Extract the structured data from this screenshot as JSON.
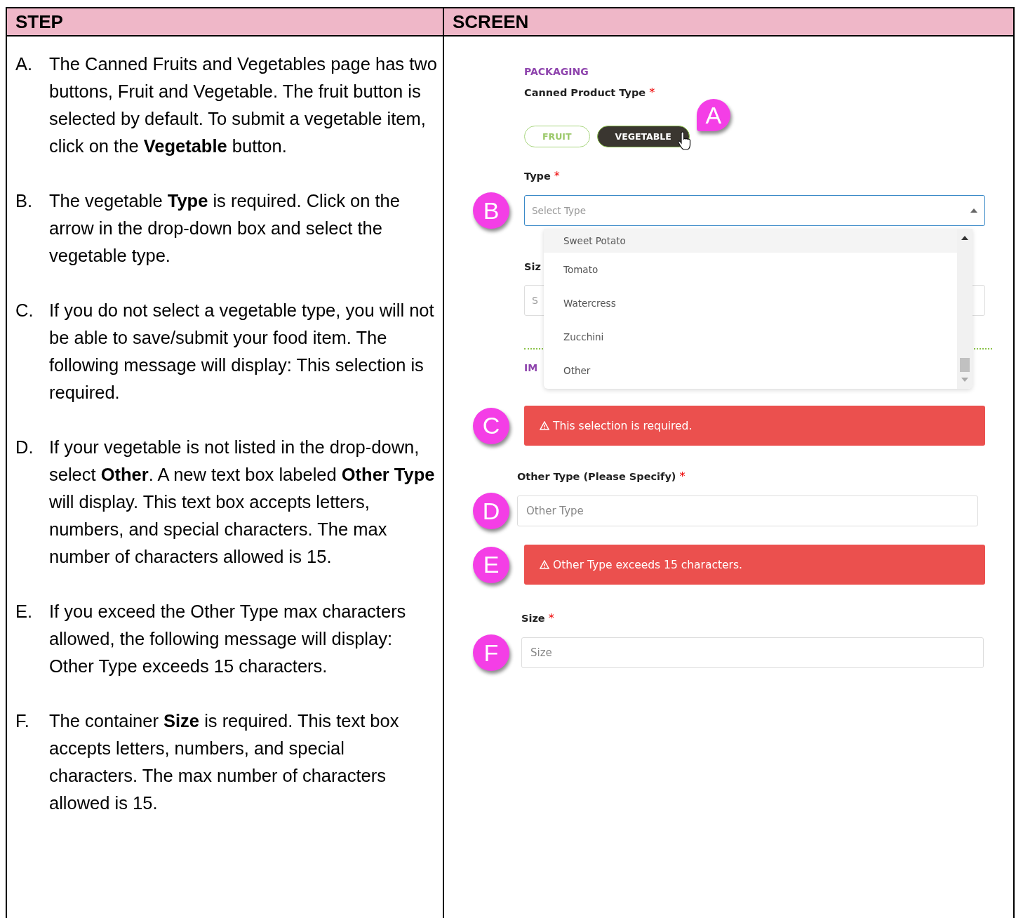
{
  "table": {
    "columns": [
      "STEP",
      "SCREEN"
    ]
  },
  "steps": [
    {
      "marker": "A.",
      "text": "The Canned Fruits and Vegetables page has two buttons, Fruit and Vegetable. The fruit button is selected by default.  To submit a vegetable item, click on the **Vegetable** button."
    },
    {
      "marker": "B.",
      "text": "The vegetable **Type** is required.  Click on the arrow in the drop-down box and select the vegetable type."
    },
    {
      "marker": "C.",
      "text": "If you do not select a vegetable type, you will not be able to save/submit your food item. The following message will display: This selection is required."
    },
    {
      "marker": "D.",
      "text": "If your vegetable is not listed in the drop-down, select **Other**.  A new text box labeled **Other Type** will display.  This text box accepts letters, numbers, and special characters.  The max number of characters allowed is 15."
    },
    {
      "marker": "E.",
      "text": "If you exceed the Other Type max characters allowed, the following message will display:  Other Type exceeds 15 characters."
    },
    {
      "marker": "F.",
      "text": "The container **Size** is required.  This text box accepts letters, numbers, and special characters.  The max number of characters allowed is 15."
    }
  ],
  "screen": {
    "section_title": "PACKAGING",
    "product_type": {
      "label": "Canned Product Type",
      "required_mark": "*",
      "badge": "A",
      "options": [
        {
          "label": "FRUIT",
          "selected": false
        },
        {
          "label": "VEGETABLE",
          "selected": true
        }
      ]
    },
    "type_field": {
      "label": "Type",
      "required_mark": "*",
      "badge": "B",
      "placeholder": "Select Type",
      "expanded": true,
      "options": [
        {
          "label": "Sweet Potato",
          "highlighted": true
        },
        {
          "label": "Tomato",
          "highlighted": false
        },
        {
          "label": "Watercress",
          "highlighted": false
        },
        {
          "label": "Zucchini",
          "highlighted": false
        },
        {
          "label": "Other",
          "highlighted": false
        }
      ]
    },
    "covered": {
      "size_label": "Siz",
      "size_placeholder": "S",
      "next_section_title": "IM"
    },
    "type_error": {
      "badge": "C",
      "message": "This selection is required."
    },
    "other_type": {
      "label": "Other Type (Please Specify)",
      "required_mark": "*",
      "badge": "D",
      "placeholder": "Other Type"
    },
    "other_type_error": {
      "badge": "E",
      "message": "Other Type exceeds 15 characters."
    },
    "size": {
      "label": "Size",
      "required_mark": "*",
      "badge": "F",
      "placeholder": "Size"
    }
  }
}
